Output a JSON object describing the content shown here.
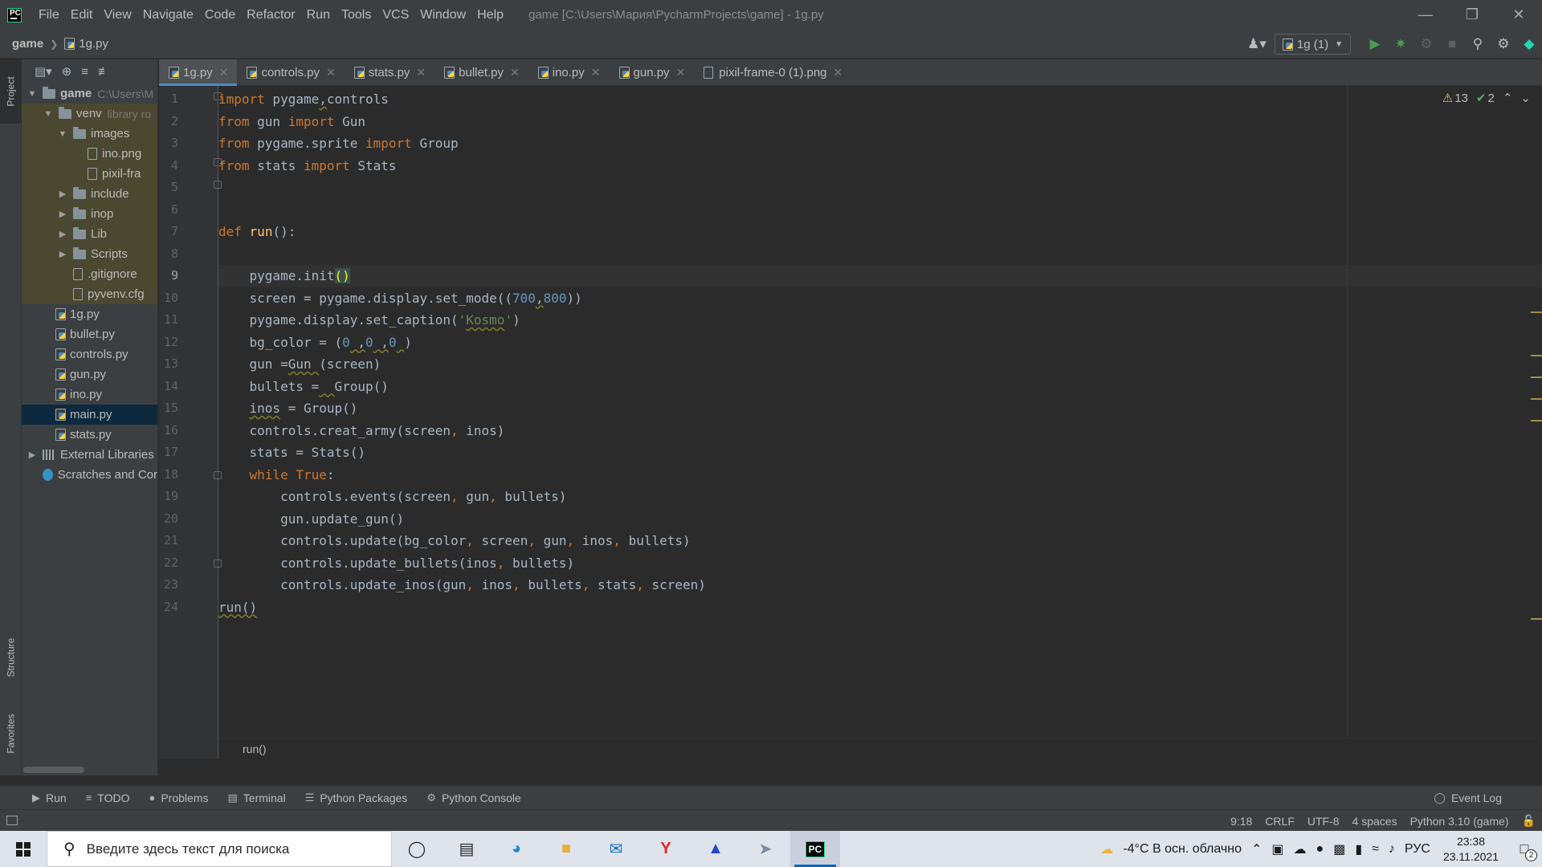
{
  "menu": {
    "items": [
      "File",
      "Edit",
      "View",
      "Navigate",
      "Code",
      "Refactor",
      "Run",
      "Tools",
      "VCS",
      "Window",
      "Help"
    ],
    "window_title": "game [C:\\Users\\Мария\\PycharmProjects\\game] - 1g.py"
  },
  "navbar": {
    "project": "game",
    "file": "1g.py",
    "run_config": "1g (1)"
  },
  "left_stripe": {
    "project": "Project",
    "structure": "Structure",
    "favorites": "Favorites"
  },
  "tree": {
    "root": {
      "name": "game",
      "hint": "C:\\Users\\M"
    },
    "venv": {
      "name": "venv",
      "hint": "library ro"
    },
    "images": "images",
    "image_files": [
      "ino.png",
      "pixil-fra"
    ],
    "folders": [
      "include",
      "inop",
      "Lib",
      "Scripts"
    ],
    "venv_files": [
      ".gitignore",
      "pyvenv.cfg"
    ],
    "files": [
      "1g.py",
      "bullet.py",
      "controls.py",
      "gun.py",
      "ino.py",
      "main.py",
      "stats.py"
    ],
    "external": "External Libraries",
    "scratches": "Scratches and Cor"
  },
  "tabs": [
    "1g.py",
    "controls.py",
    "stats.py",
    "bullet.py",
    "ino.py",
    "gun.py",
    "pixil-frame-0 (1).png"
  ],
  "inspections": {
    "warnings": "13",
    "ok": "2"
  },
  "editor": {
    "line_numbers": [
      "1",
      "2",
      "3",
      "4",
      "5",
      "6",
      "7",
      "8",
      "9",
      "10",
      "11",
      "12",
      "13",
      "14",
      "15",
      "16",
      "17",
      "18",
      "19",
      "20",
      "21",
      "22",
      "23",
      "24"
    ],
    "breadcrumb": "run()"
  },
  "bottom_tools": [
    "Run",
    "TODO",
    "Problems",
    "Terminal",
    "Python Packages",
    "Python Console"
  ],
  "event_log": "Event Log",
  "status": {
    "position": "9:18",
    "line_sep": "CRLF",
    "encoding": "UTF-8",
    "indent": "4 spaces",
    "interpreter": "Python 3.10 (game)"
  },
  "taskbar": {
    "search_placeholder": "Введите здесь текст для поиска",
    "weather": "-4°C  В осн. облачно",
    "lang": "РУС",
    "time": "23:38",
    "date": "23.11.2021",
    "notifications": "2"
  },
  "colors": {
    "keyword": "#cc7832",
    "function": "#ffc66d",
    "number": "#6897bb",
    "string": "#6a8759",
    "accent": "#4a88c7"
  }
}
